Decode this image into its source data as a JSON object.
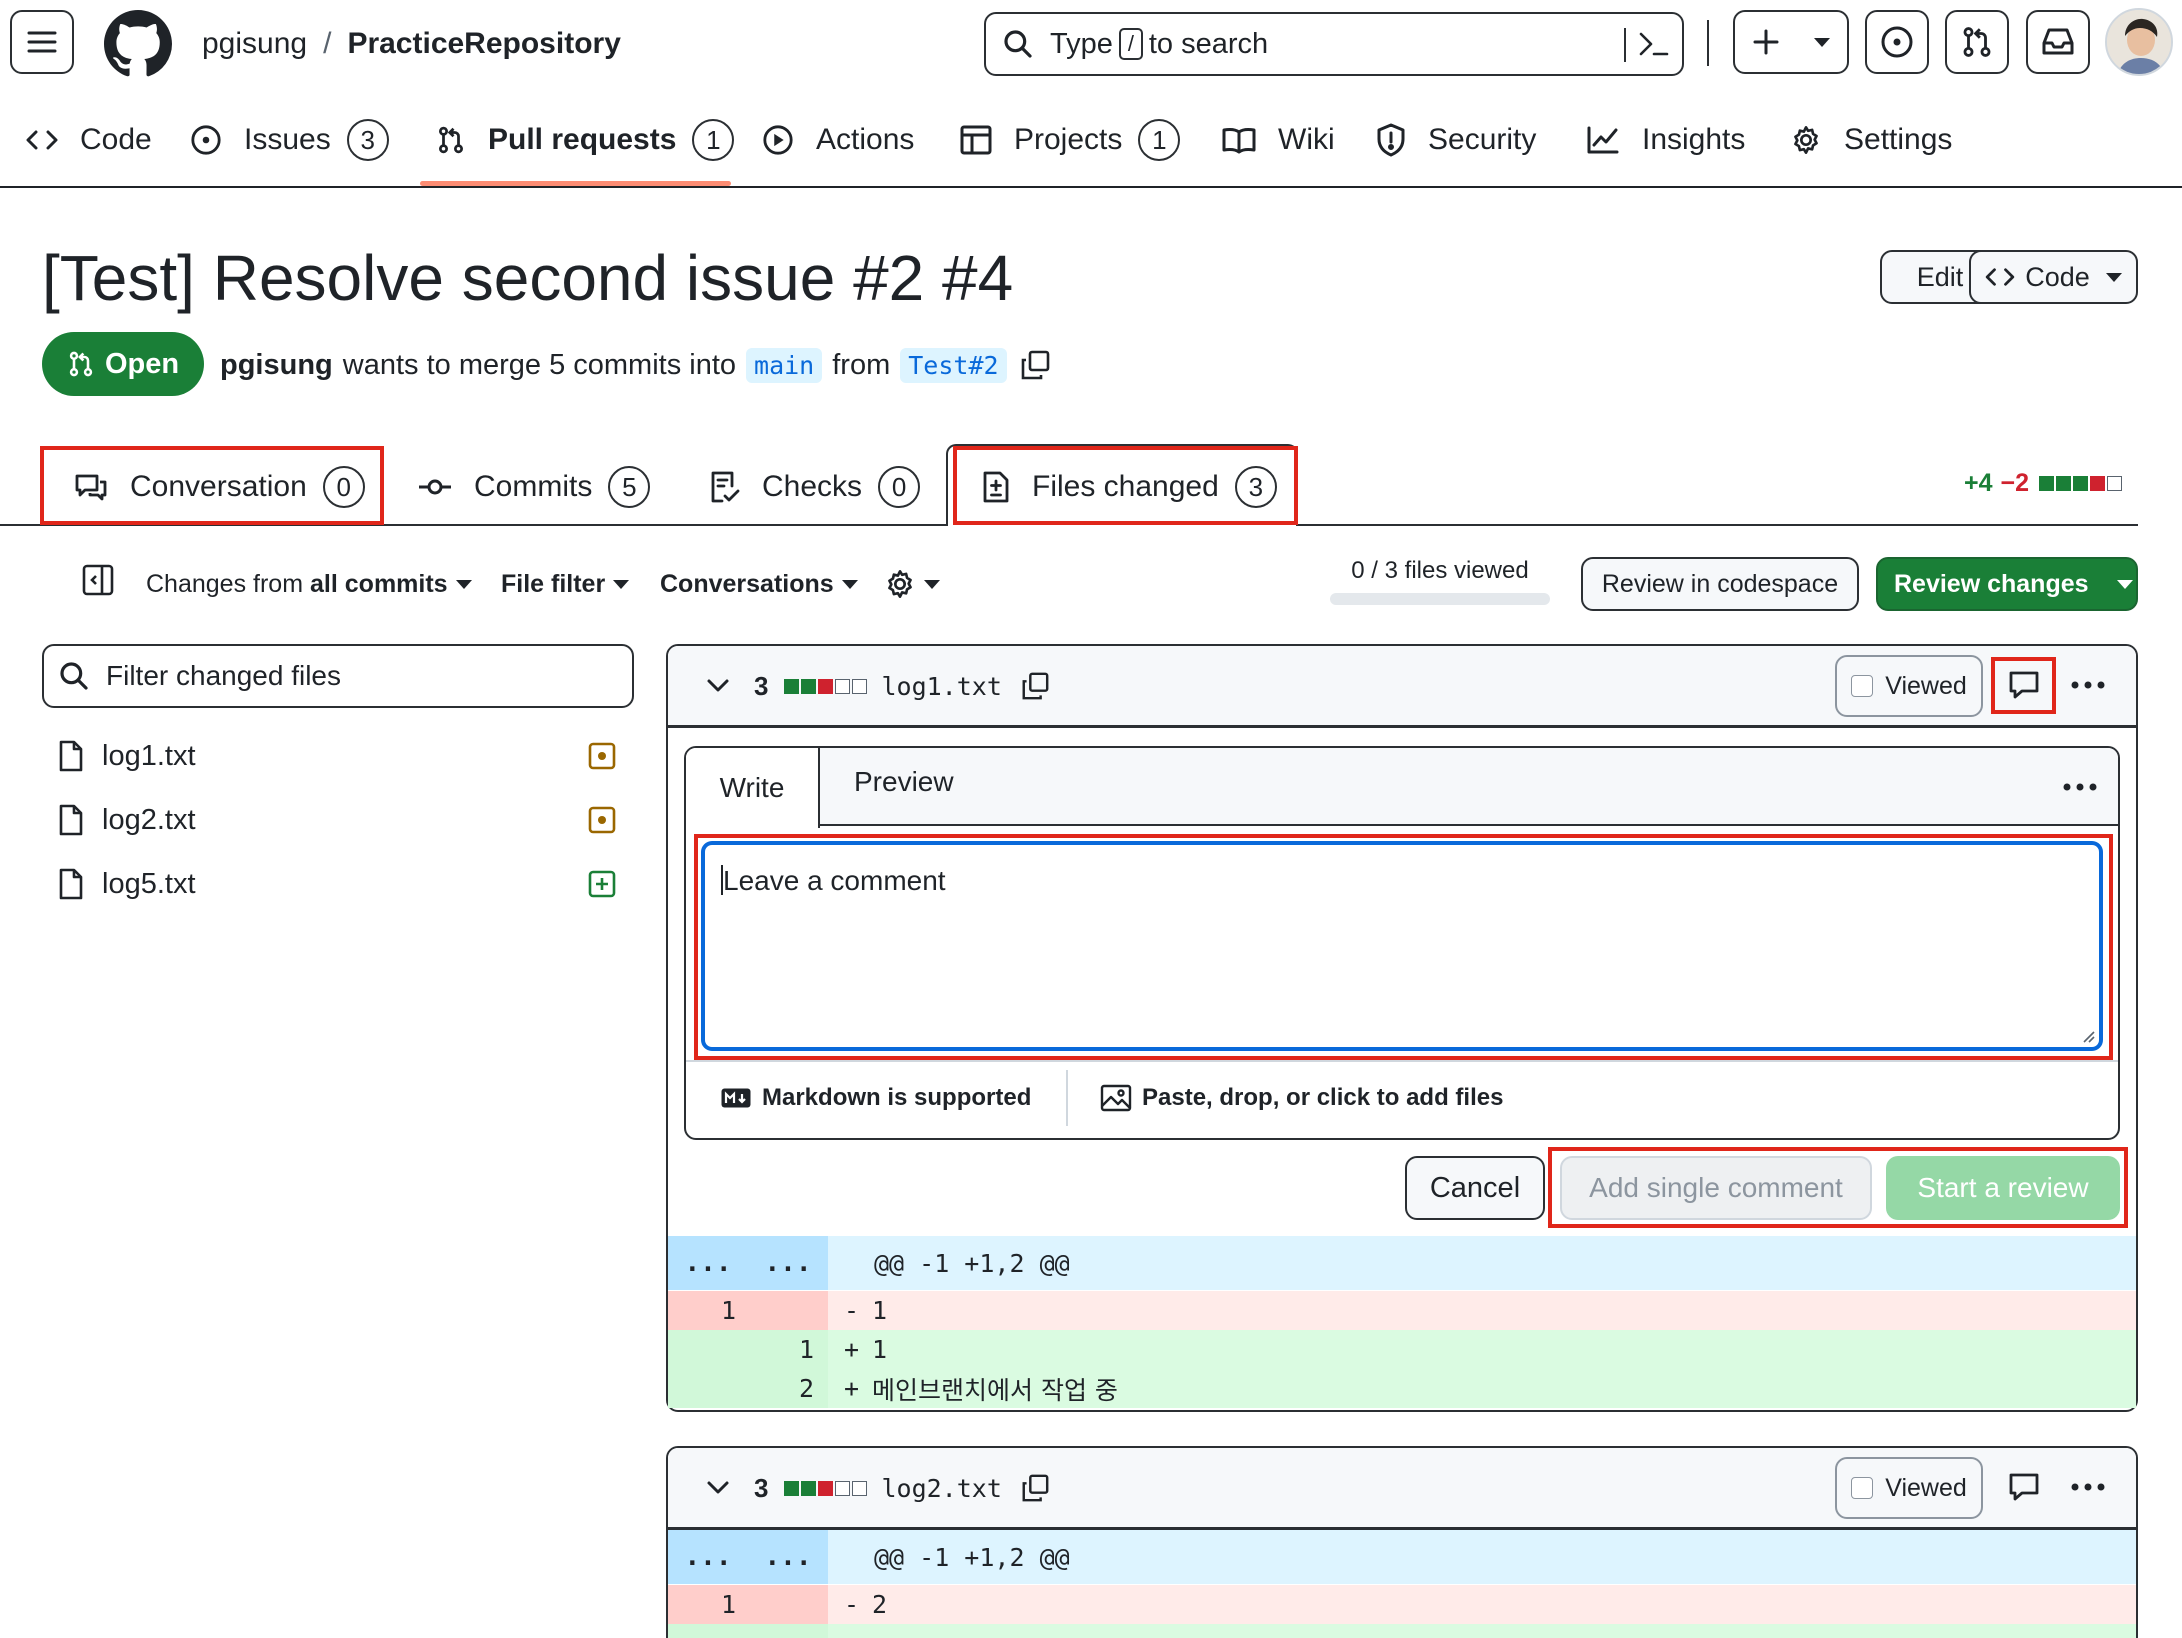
{
  "header": {
    "owner": "pgisung",
    "separator": "/",
    "repo": "PracticeRepository",
    "search_type": "Type",
    "search_key": "/",
    "search_rest": "to search"
  },
  "nav": {
    "items": [
      {
        "label": "Code"
      },
      {
        "label": "Issues",
        "count": "3"
      },
      {
        "label": "Pull requests",
        "count": "1"
      },
      {
        "label": "Actions"
      },
      {
        "label": "Projects",
        "count": "1"
      },
      {
        "label": "Wiki"
      },
      {
        "label": "Security"
      },
      {
        "label": "Insights"
      },
      {
        "label": "Settings"
      }
    ]
  },
  "pr": {
    "title": "[Test] Resolve second issue #2 #4",
    "edit_label": "Edit",
    "code_label": "Code",
    "state": "Open",
    "author": "pgisung",
    "merge_text": "wants to merge 5 commits into",
    "base_branch": "main",
    "from_text": "from",
    "head_branch": "Test#2"
  },
  "tabs": [
    {
      "label": "Conversation",
      "count": "0"
    },
    {
      "label": "Commits",
      "count": "5"
    },
    {
      "label": "Checks",
      "count": "0"
    },
    {
      "label": "Files changed",
      "count": "3"
    }
  ],
  "diffstat": {
    "additions": "+4",
    "deletions": "−2"
  },
  "toolbar": {
    "changes_prefix": "Changes from",
    "changes_value": "all commits",
    "file_filter": "File filter",
    "conversations": "Conversations",
    "files_viewed": "0 / 3 files viewed",
    "files_viewed_progress": 0,
    "review_codespace": "Review in codespace",
    "review_changes": "Review changes"
  },
  "sidebar": {
    "filter_placeholder": "Filter changed files",
    "files": [
      {
        "name": "log1.txt",
        "status": "modified"
      },
      {
        "name": "log2.txt",
        "status": "modified"
      },
      {
        "name": "log5.txt",
        "status": "added"
      }
    ]
  },
  "file1": {
    "changes": "3",
    "name": "log1.txt",
    "viewed_label": "Viewed",
    "comment": {
      "tab_write": "Write",
      "tab_preview": "Preview",
      "placeholder": "Leave a comment",
      "markdown_note": "Markdown is supported",
      "attach_note": "Paste, drop, or click to add files",
      "cancel": "Cancel",
      "add_single": "Add single comment",
      "start_review": "Start a review"
    },
    "hunk_header": "@@ -1 +1,2 @@",
    "expand": "...",
    "lines": [
      {
        "old": "1",
        "new": "",
        "sign": "-",
        "text": "1",
        "type": "del"
      },
      {
        "old": "",
        "new": "1",
        "sign": "+",
        "text": "1",
        "type": "add"
      },
      {
        "old": "",
        "new": "2",
        "sign": "+",
        "text": "메인브랜치에서 작업 중",
        "type": "add"
      }
    ]
  },
  "file2": {
    "changes": "3",
    "name": "log2.txt",
    "viewed_label": "Viewed",
    "hunk_header": "@@ -1 +1,2 @@",
    "expand": "...",
    "lines": [
      {
        "old": "1",
        "new": "",
        "sign": "-",
        "text": "2",
        "type": "del"
      }
    ]
  },
  "colors": {
    "accent_green": "#1f883d",
    "open_badge": "#1a7f37",
    "deletion_bg": "#ffebe9",
    "addition_bg": "#dafbe1",
    "hunk_bg": "#ddf4ff",
    "highlight_box": "#e0261a"
  }
}
